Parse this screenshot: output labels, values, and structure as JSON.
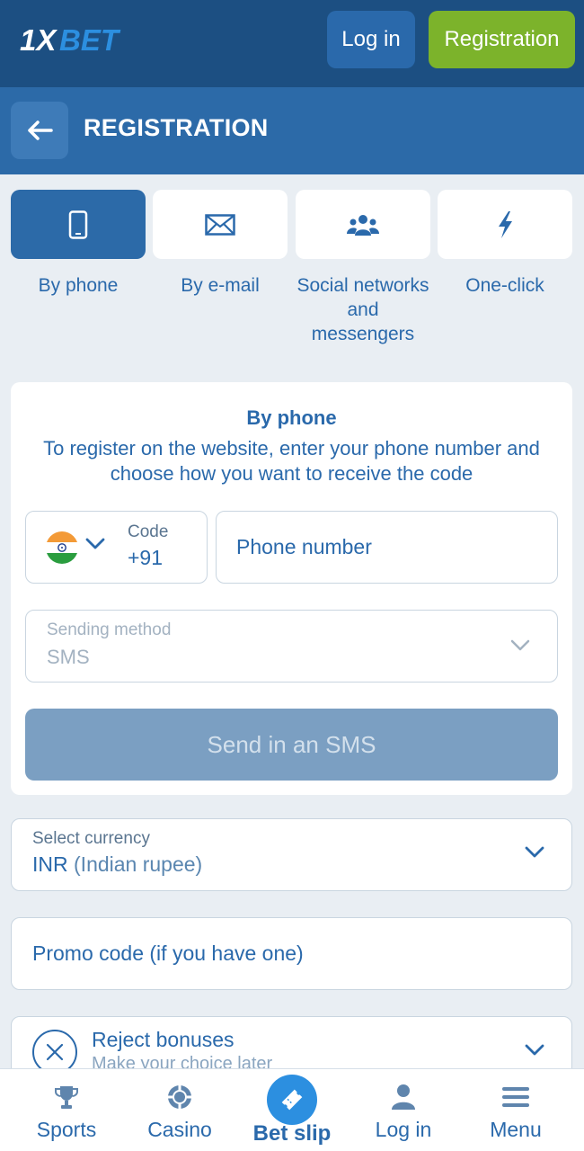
{
  "header": {
    "logo_text": "1XBET",
    "login_label": "Log in",
    "registration_label": "Registration"
  },
  "reg_bar": {
    "title": "REGISTRATION"
  },
  "tabs": [
    {
      "label": "By phone",
      "icon": "smartphone-icon",
      "active": true
    },
    {
      "label": "By e-mail",
      "icon": "envelope-icon",
      "active": false
    },
    {
      "label": "Social networks and messengers",
      "icon": "users-icon",
      "active": false
    },
    {
      "label": "One-click",
      "icon": "lightning-icon",
      "active": false
    }
  ],
  "phone_form": {
    "title": "By phone",
    "description": "To register on the website, enter your phone number and choose how you want to receive the code",
    "code_label": "Code",
    "code_value": "+91",
    "phone_placeholder": "Phone number",
    "method_label": "Sending method",
    "method_value": "SMS",
    "send_label": "Send in an SMS"
  },
  "currency": {
    "label": "Select currency",
    "code": "INR",
    "name": "(Indian rupee)"
  },
  "promo": {
    "placeholder": "Promo code (if you have one)"
  },
  "bonus": {
    "title": "Reject bonuses",
    "subtitle": "Make your choice later"
  },
  "bottom_nav": {
    "sports": "Sports",
    "casino": "Casino",
    "betslip": "Bet slip",
    "login": "Log in",
    "menu": "Menu"
  },
  "colors": {
    "header_bg": "#1c4f82",
    "reg_bar_bg": "#2c6aa8",
    "accent_green": "#7cb32b",
    "text_blue": "#2a69ab",
    "send_disabled": "#7b9fc2"
  }
}
